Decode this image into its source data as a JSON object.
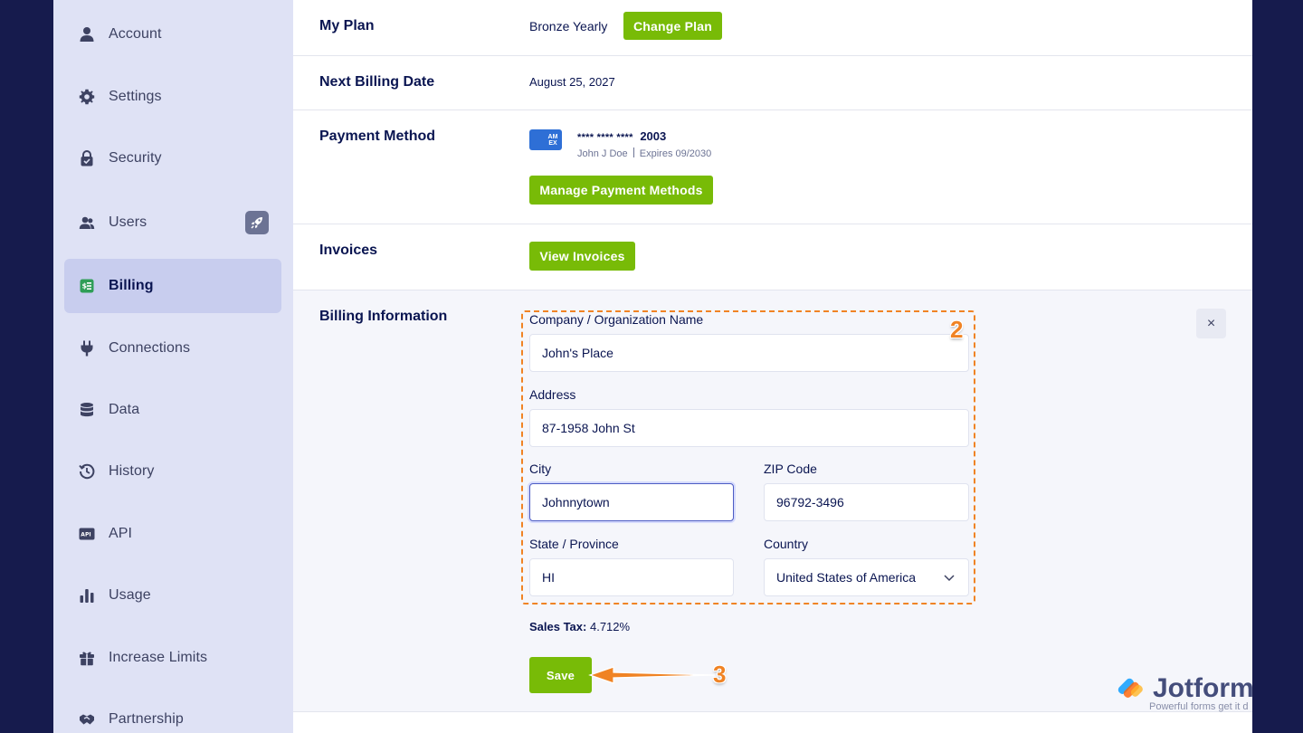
{
  "sidebar": {
    "items": [
      {
        "label": "Account",
        "icon": "user-icon"
      },
      {
        "label": "Settings",
        "icon": "gear-icon"
      },
      {
        "label": "Security",
        "icon": "lock-icon"
      },
      {
        "label": "Users",
        "icon": "users-icon"
      },
      {
        "label": "Billing",
        "icon": "billing-icon",
        "active": true
      },
      {
        "label": "Connections",
        "icon": "plug-icon"
      },
      {
        "label": "Data",
        "icon": "database-icon"
      },
      {
        "label": "History",
        "icon": "history-icon"
      },
      {
        "label": "API",
        "icon": "api-icon"
      },
      {
        "label": "Usage",
        "icon": "bar-chart-icon"
      },
      {
        "label": "Increase Limits",
        "icon": "gift-icon"
      },
      {
        "label": "Partnership",
        "icon": "handshake-icon"
      }
    ]
  },
  "plan": {
    "label": "My Plan",
    "value": "Bronze Yearly",
    "button": "Change Plan"
  },
  "next_billing": {
    "label": "Next Billing Date",
    "value": "August 25, 2027"
  },
  "payment": {
    "label": "Payment Method",
    "card_masked": "**** **** ****",
    "card_last4": "2003",
    "card_brand_icon": "amex-card-icon",
    "card_brand_text": "AM EX",
    "holder": "John J Doe",
    "expires": "Expires 09/2030",
    "button": "Manage Payment Methods"
  },
  "invoices": {
    "label": "Invoices",
    "button": "View Invoices"
  },
  "billing_info": {
    "label": "Billing Information",
    "close": "×",
    "company_label": "Company / Organization Name",
    "company_value": "John's Place",
    "address_label": "Address",
    "address_value": "87-1958 John St",
    "city_label": "City",
    "city_value": "Johnnytown",
    "zip_label": "ZIP Code",
    "zip_value": "96792-3496",
    "state_label": "State / Province",
    "state_value": "HI",
    "country_label": "Country",
    "country_value": "United States of America",
    "tax_label": "Sales Tax:",
    "tax_value": "4.712%",
    "save": "Save"
  },
  "annotations": {
    "step2": "2",
    "step3": "3",
    "accent": "#f08324"
  },
  "watermark": {
    "brand": "Jotform",
    "tagline": "Powerful forms get it d"
  },
  "colors": {
    "green": "#78bb07",
    "navy": "#0a1551",
    "sidebar": "#dfe2f5",
    "active": "#c8cdee"
  }
}
